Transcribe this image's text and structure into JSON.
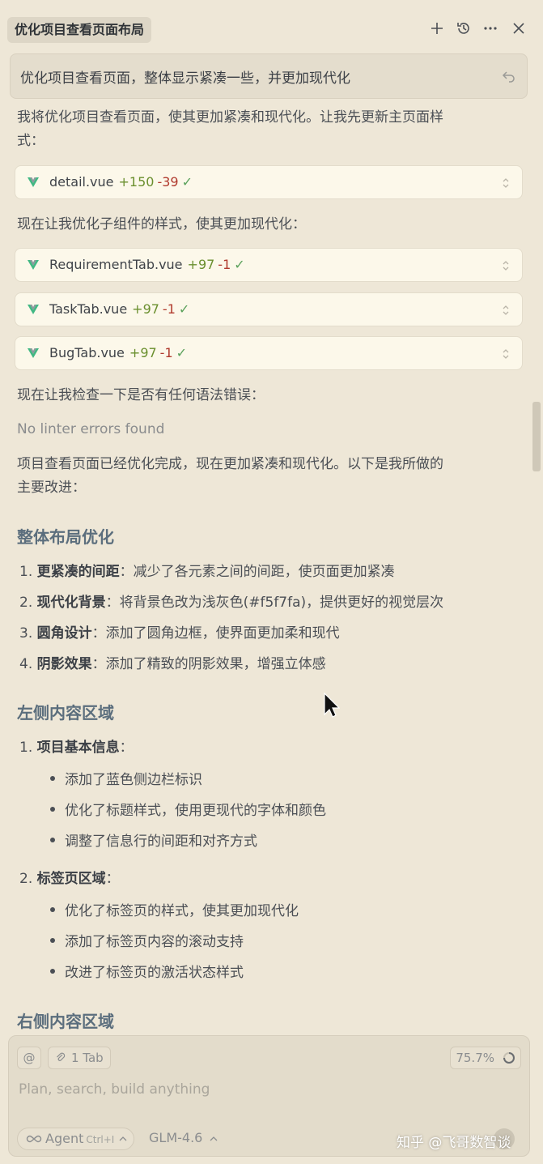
{
  "header": {
    "title": "优化项目查看页面布局"
  },
  "user_message": {
    "text": "优化项目查看页面，整体显示紧凑一些，并更加现代化"
  },
  "content": {
    "intro_line1": "我将优化项目查看页面，使其更加紧凑和现代化。让我先更新主页面样",
    "intro_line2": "式：",
    "files_main": [
      {
        "name": "detail.vue",
        "added": "+150",
        "removed": "-39",
        "check": "✓"
      }
    ],
    "sub_intro": "现在让我优化子组件的样式，使其更加现代化：",
    "files_sub": [
      {
        "name": "RequirementTab.vue",
        "added": "+97",
        "removed": "-1",
        "check": "✓"
      },
      {
        "name": "TaskTab.vue",
        "added": "+97",
        "removed": "-1",
        "check": "✓"
      },
      {
        "name": "BugTab.vue",
        "added": "+97",
        "removed": "-1",
        "check": "✓"
      }
    ],
    "check_text": "现在让我检查一下是否有任何语法错误：",
    "linter": "No linter errors found",
    "summary_line1": "项目查看页面已经优化完成，现在更加紧凑和现代化。以下是我所做的",
    "summary_line2": "主要改进：",
    "section1": {
      "heading": "整体布局优化",
      "items": [
        {
          "num": "1.",
          "bold": "更紧凑的间距",
          "rest": "：减少了各元素之间的间距，使页面更加紧凑"
        },
        {
          "num": "2.",
          "bold": "现代化背景",
          "rest": "：将背景色改为浅灰色(#f5f7fa)，提供更好的视觉层次"
        },
        {
          "num": "3.",
          "bold": "圆角设计",
          "rest": "：添加了圆角边框，使界面更加柔和现代"
        },
        {
          "num": "4.",
          "bold": "阴影效果",
          "rest": "：添加了精致的阴影效果，增强立体感"
        }
      ]
    },
    "section2": {
      "heading": "左侧内容区域",
      "groups": [
        {
          "num": "1.",
          "bold": "项目基本信息",
          "rest": "：",
          "bullets": [
            "添加了蓝色侧边栏标识",
            "优化了标题样式，使用更现代的字体和颜色",
            "调整了信息行的间距和对齐方式"
          ]
        },
        {
          "num": "2.",
          "bold": "标签页区域",
          "rest": "：",
          "bullets": [
            "优化了标签页的样式，使其更加现代化",
            "添加了标签页内容的滚动支持",
            "改进了标签页的激活状态样式"
          ]
        }
      ]
    },
    "section3": {
      "heading": "右侧内容区域"
    }
  },
  "composer": {
    "at_label": "@",
    "tab_label": "1 Tab",
    "context_pct": "75.7%",
    "placeholder": "Plan, search, build anything",
    "agent_label": "Agent",
    "agent_shortcut": "Ctrl+I",
    "model": "GLM-4.6"
  },
  "watermark": "知乎 @飞哥数智谈",
  "colors": {
    "background": "#eee7d7",
    "vue_green": "#41b883",
    "added": "#6a8f2e",
    "removed": "#b03a2e",
    "heading": "#5b6e7d"
  }
}
